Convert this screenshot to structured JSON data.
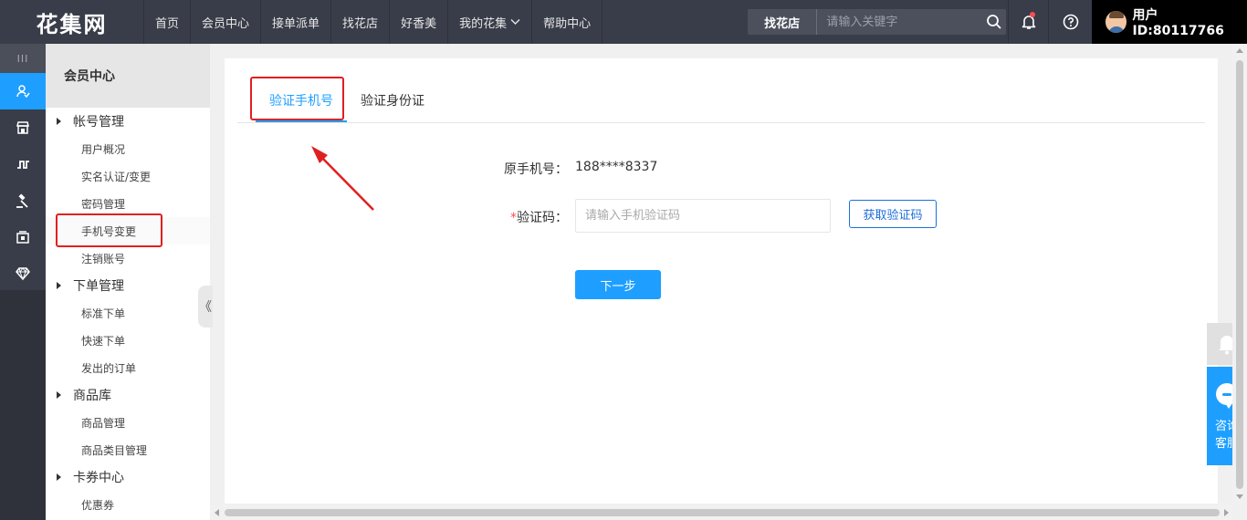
{
  "header": {
    "logo_text": "花集网",
    "nav": [
      "首页",
      "会员中心",
      "接单派单",
      "找花店",
      "好香美",
      "我的花集",
      "帮助中心"
    ],
    "search_scope": "找花店",
    "search_placeholder": "请输入关键字",
    "user_label": "用户ID:80117766"
  },
  "sidebar": {
    "title": "会员中心",
    "groups": [
      {
        "label": "帐号管理",
        "items": [
          "用户概况",
          "实名认证/变更",
          "密码管理",
          "手机号变更",
          "注销账号"
        ]
      },
      {
        "label": "下单管理",
        "items": [
          "标准下单",
          "快速下单",
          "发出的订单"
        ]
      },
      {
        "label": "商品库",
        "items": [
          "商品管理",
          "商品类目管理"
        ]
      },
      {
        "label": "卡券中心",
        "items": [
          "优惠券"
        ]
      }
    ],
    "active_item": "手机号变更",
    "collapse_glyph": "《"
  },
  "tabs": [
    "验证手机号",
    "验证身份证"
  ],
  "form": {
    "original_phone_label": "原手机号：",
    "original_phone_value": "188****8337",
    "code_required_mark": "*",
    "code_label": "验证码：",
    "code_placeholder": "请输入手机验证码",
    "get_code_button": "获取验证码",
    "next_button": "下一步"
  },
  "float_widget": {
    "consult_label_line1": "咨询",
    "consult_label_line2": "客服"
  },
  "colors": {
    "topbar": "#393d49",
    "accent": "#1e9fff",
    "annotation": "#e02020"
  }
}
